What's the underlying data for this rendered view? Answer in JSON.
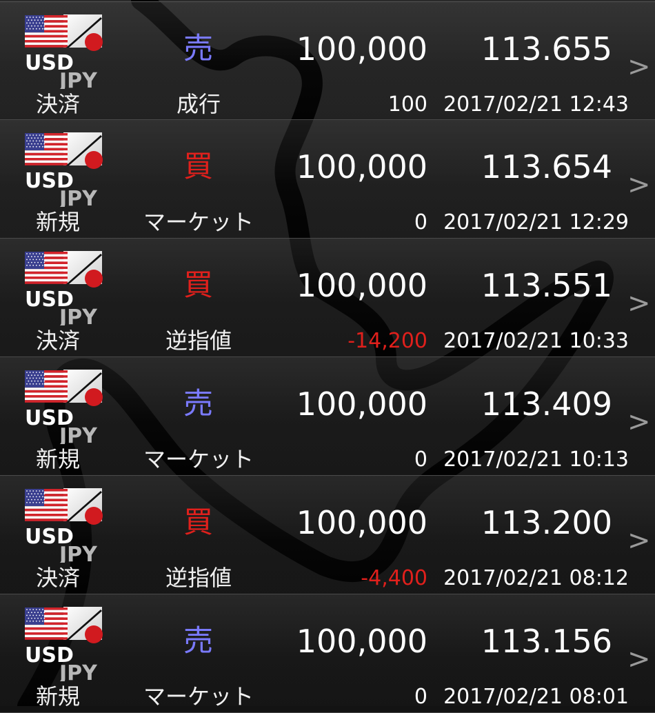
{
  "orders": [
    {
      "pair_base": "USD",
      "pair_quote": "JPY",
      "side": "売",
      "side_type": "sell",
      "quantity": "100,000",
      "price": "113.655",
      "kind": "決済",
      "order_type": "成行",
      "pnl": "100",
      "pnl_negative": false,
      "timestamp": "2017/02/21 12:43"
    },
    {
      "pair_base": "USD",
      "pair_quote": "JPY",
      "side": "買",
      "side_type": "buy",
      "quantity": "100,000",
      "price": "113.654",
      "kind": "新規",
      "order_type": "マーケット",
      "pnl": "0",
      "pnl_negative": false,
      "timestamp": "2017/02/21 12:29"
    },
    {
      "pair_base": "USD",
      "pair_quote": "JPY",
      "side": "買",
      "side_type": "buy",
      "quantity": "100,000",
      "price": "113.551",
      "kind": "決済",
      "order_type": "逆指値",
      "pnl": "-14,200",
      "pnl_negative": true,
      "timestamp": "2017/02/21 10:33"
    },
    {
      "pair_base": "USD",
      "pair_quote": "JPY",
      "side": "売",
      "side_type": "sell",
      "quantity": "100,000",
      "price": "113.409",
      "kind": "新規",
      "order_type": "マーケット",
      "pnl": "0",
      "pnl_negative": false,
      "timestamp": "2017/02/21 10:13"
    },
    {
      "pair_base": "USD",
      "pair_quote": "JPY",
      "side": "買",
      "side_type": "buy",
      "quantity": "100,000",
      "price": "113.200",
      "kind": "決済",
      "order_type": "逆指値",
      "pnl": "-4,400",
      "pnl_negative": true,
      "timestamp": "2017/02/21 08:12"
    },
    {
      "pair_base": "USD",
      "pair_quote": "JPY",
      "side": "売",
      "side_type": "sell",
      "quantity": "100,000",
      "price": "113.156",
      "kind": "新規",
      "order_type": "マーケット",
      "pnl": "0",
      "pnl_negative": false,
      "timestamp": "2017/02/21 08:01"
    }
  ],
  "chevron_icon": "chevron-right-icon",
  "flag_icon": "usd-jpy-flag-icon",
  "colors": {
    "sell": "#7a7aff",
    "buy": "#e0201c",
    "negative_pnl": "#e0201c",
    "text": "#ffffff",
    "divider": "#4a4a4a",
    "background": "#141414"
  }
}
